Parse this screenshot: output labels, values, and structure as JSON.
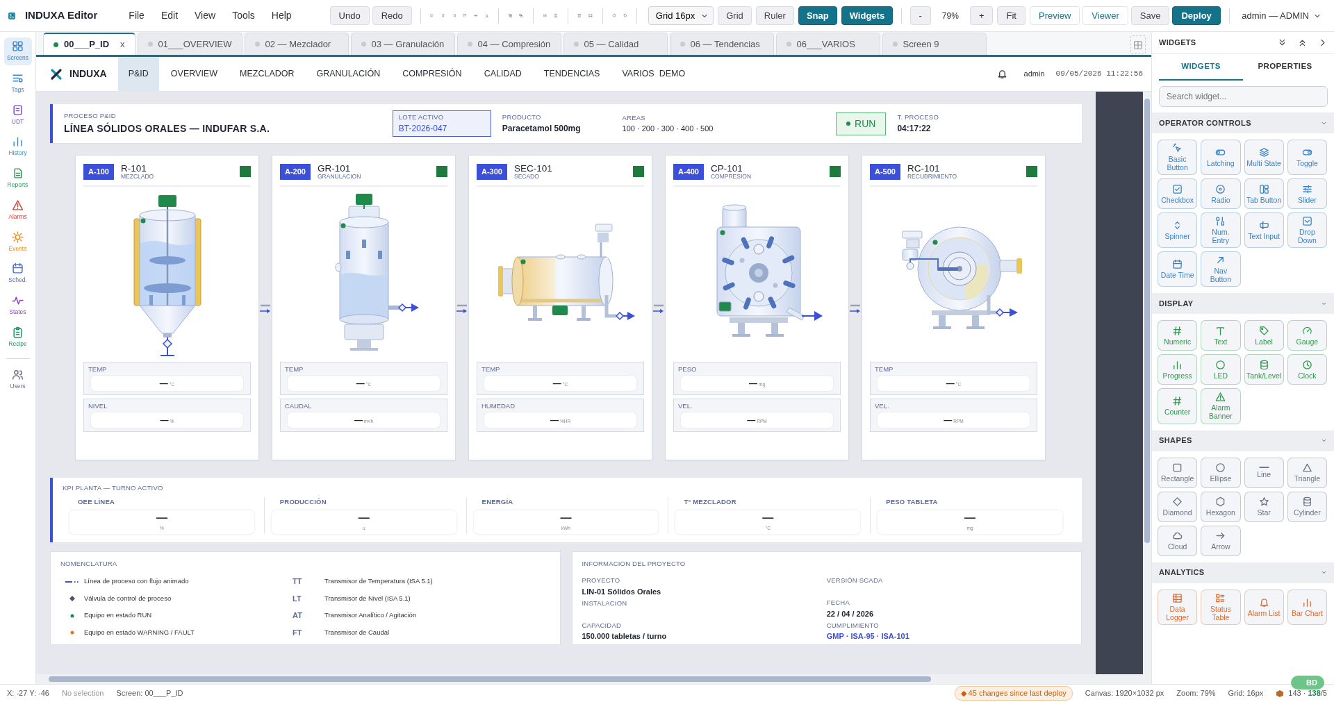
{
  "app": {
    "title": "INDUXA Editor",
    "menu": [
      "File",
      "Edit",
      "View",
      "Tools",
      "Help"
    ],
    "history_buttons": [
      "Undo",
      "Redo"
    ],
    "grid_select": "Grid 16px",
    "toggles": [
      {
        "label": "Grid",
        "on": false
      },
      {
        "label": "Ruler",
        "on": false
      },
      {
        "label": "Snap",
        "on": true
      },
      {
        "label": "Widgets",
        "on": true
      }
    ],
    "zoom": {
      "minus": "-",
      "value": "79%",
      "plus": "+",
      "fit": "Fit"
    },
    "actions": [
      {
        "label": "Preview",
        "kind": "link"
      },
      {
        "label": "Viewer",
        "kind": "link"
      },
      {
        "label": "Save",
        "kind": "plain"
      },
      {
        "label": "Deploy",
        "kind": "primary"
      }
    ],
    "user": "admin — ADMIN"
  },
  "rail": [
    [
      {
        "label": "Screens",
        "selected": true,
        "color": "#3b82c4"
      },
      {
        "label": "Tags",
        "selected": false,
        "color": "#3b82c4"
      },
      {
        "label": "UDT",
        "selected": false,
        "color": "#7c4dcc"
      },
      {
        "label": "History",
        "selected": false,
        "color": "#3b8fd0"
      },
      {
        "label": "Reports",
        "selected": false,
        "color": "#2e9a5a"
      },
      {
        "label": "Alarms",
        "selected": false,
        "color": "#e0413a"
      },
      {
        "label": "Events",
        "selected": false,
        "color": "#f08c1a"
      },
      {
        "label": "Sched.",
        "selected": false,
        "color": "#4a6fd0"
      },
      {
        "label": "States",
        "selected": false,
        "color": "#8a3fd0"
      },
      {
        "label": "Recipe",
        "selected": false,
        "color": "#1f9a6a"
      }
    ],
    [
      {
        "label": "Users",
        "selected": false,
        "color": "#6b7280"
      }
    ]
  ],
  "tabs": [
    {
      "label": "00___P_ID",
      "selected": true,
      "close": "x"
    },
    {
      "label": "01___OVERVIEW",
      "selected": false
    },
    {
      "label": "02 — Mezclador",
      "selected": false
    },
    {
      "label": "03 — Granulación",
      "selected": false
    },
    {
      "label": "04 — Compresión",
      "selected": false
    },
    {
      "label": "05 — Calidad",
      "selected": false
    },
    {
      "label": "06 — Tendencias",
      "selected": false
    },
    {
      "label": "06___VARIOS",
      "selected": false
    },
    {
      "label": "Screen 9",
      "selected": false
    }
  ],
  "screen_nav": {
    "brand": "INDUXA",
    "items": [
      {
        "label": "P&ID",
        "selected": true
      },
      {
        "label": "OVERVIEW",
        "selected": false
      },
      {
        "label": "MEZCLADOR",
        "selected": false
      },
      {
        "label": "GRANULACIÓN",
        "selected": false
      },
      {
        "label": "COMPRESIÓN",
        "selected": false
      },
      {
        "label": "CALIDAD",
        "selected": false
      },
      {
        "label": "TENDENCIAS",
        "selected": false
      },
      {
        "label": "VARIOS  DEMO",
        "selected": false
      }
    ],
    "user": "admin",
    "datetime": "09/05/2026 11:22:56"
  },
  "header": {
    "section": "PROCESO P&ID",
    "title": "LÍNEA SÓLIDOS ORALES — INDUFAR S.A.",
    "lot": {
      "label": "LOTE ACTIVO",
      "value": "BT-2026-047"
    },
    "product": {
      "label": "PRODUCTO",
      "value": "Paracetamol 500mg"
    },
    "areas": {
      "label": "AREAS",
      "value": "100 · 200 · 300 · 400 · 500"
    },
    "state": {
      "label": "RUN",
      "kind": "run"
    },
    "process_time": {
      "label": "T. PROCESO",
      "value": "04:17:22"
    }
  },
  "equipment": [
    {
      "area": "A-100",
      "tag": "R-101",
      "desc": "MEZCLADO",
      "kind": "mixer",
      "color": "#1f7a3f",
      "readings": [
        {
          "label": "TEMP",
          "value": "—",
          "unit": "°C"
        },
        {
          "label": "NIVEL",
          "value": "—",
          "unit": "%"
        }
      ]
    },
    {
      "area": "A-200",
      "tag": "GR-101",
      "desc": "GRANULACION",
      "kind": "granulator",
      "color": "#1f7a3f",
      "readings": [
        {
          "label": "TEMP",
          "value": "—",
          "unit": "°C"
        },
        {
          "label": "CAUDAL",
          "value": "—",
          "unit": "m³/h"
        }
      ]
    },
    {
      "area": "A-300",
      "tag": "SEC-101",
      "desc": "SECADO",
      "kind": "dryer",
      "color": "#1f7a3f",
      "readings": [
        {
          "label": "TEMP",
          "value": "—",
          "unit": "°C"
        },
        {
          "label": "HUMEDAD",
          "value": "—",
          "unit": "%HR"
        }
      ]
    },
    {
      "area": "A-400",
      "tag": "CP-101",
      "desc": "COMPRESION",
      "kind": "press",
      "color": "#1f7a3f",
      "readings": [
        {
          "label": "PESO",
          "value": "—",
          "unit": "mg"
        },
        {
          "label": "VEL.",
          "value": "—",
          "unit": "RPM"
        }
      ]
    },
    {
      "area": "A-500",
      "tag": "RC-101",
      "desc": "RECUBRIMIENTO",
      "kind": "coater",
      "color": "#1f7a3f",
      "readings": [
        {
          "label": "TEMP",
          "value": "—",
          "unit": "°C"
        },
        {
          "label": "VEL.",
          "value": "—",
          "unit": "RPM"
        }
      ]
    }
  ],
  "kpi": {
    "title": "KPI PLANTA — TURNO ACTIVO",
    "items": [
      {
        "label": "OEE LÍNEA",
        "value": "—",
        "unit": "%"
      },
      {
        "label": "PRODUCCIÓN",
        "value": "—",
        "unit": "u"
      },
      {
        "label": "ENERGÍA",
        "value": "—",
        "unit": "kWh"
      },
      {
        "label": "T° MEZCLADOR",
        "value": "—",
        "unit": "°C"
      },
      {
        "label": "PESO TABLETA",
        "value": "—",
        "unit": "mg"
      }
    ]
  },
  "nomenclature": {
    "title": "NOMENCLATURA",
    "items": [
      {
        "kind": "flow-line",
        "text": "Línea de proceso con flujo animado"
      },
      {
        "kind": "valve",
        "text": "Válvula de control de proceso"
      },
      {
        "kind": "run",
        "text": "Equipo en estado RUN"
      },
      {
        "kind": "fault",
        "text": "Equipo en estado WARNING / FAULT"
      }
    ],
    "codes": [
      {
        "code": "TT",
        "text": "Transmisor de Temperatura (ISA 5.1)"
      },
      {
        "code": "LT",
        "text": "Transmisor de Nivel (ISA 5.1)"
      },
      {
        "code": "AT",
        "text": "Transmisor Analítico / Agitación"
      },
      {
        "code": "FT",
        "text": "Transmisor de Caudal"
      }
    ]
  },
  "project": {
    "title": "INFORMACION DEL PROYECTO",
    "columns": [
      [
        {
          "label": "PROYECTO",
          "value": "LIN-01 Sólidos Orales",
          "accent": false
        },
        {
          "label": "INSTALACION",
          "accent": false
        },
        {
          "label": "CAPACIDAD",
          "value": "150.000 tabletas / turno",
          "accent": false
        }
      ],
      [
        {
          "label": "VERSIÓN SCADA",
          "accent": false
        },
        {
          "label": "FECHA",
          "value": "22 / 04 / 2026",
          "accent": false
        },
        {
          "label": "CUMPLIMIENTO",
          "value": "GMP · ISA-95 · ISA-101",
          "accent": true
        }
      ]
    ]
  },
  "panel": {
    "title": "WIDGETS",
    "tabs": [
      {
        "label": "WIDGETS",
        "selected": true
      },
      {
        "label": "PROPERTIES",
        "selected": false
      }
    ],
    "search": {
      "placeholder": "Search widget..."
    },
    "sections": [
      {
        "title": "OPERATOR CONTROLS",
        "color": "#3b82c4",
        "items": [
          "Basic Button",
          "Latching",
          "Multi State",
          "Toggle",
          "Checkbox",
          "Radio",
          "Tab Button",
          "Slider",
          "Spinner",
          "Num. Entry",
          "Text Input",
          "Drop Down",
          "Date Time",
          "Nav Button"
        ]
      },
      {
        "title": "DISPLAY",
        "color": "#2e9a4a",
        "items": [
          "Numeric",
          "Text",
          "Label",
          "Gauge",
          "Progress",
          "LED",
          "Tank/Level",
          "Clock",
          "Counter",
          "Alarm Banner"
        ]
      },
      {
        "title": "SHAPES",
        "color": "#6b7280",
        "items": [
          "Rectangle",
          "Ellipse",
          "Line",
          "Triangle",
          "Diamond",
          "Hexagon",
          "Star",
          "Cylinder",
          "Cloud",
          "Arrow"
        ]
      },
      {
        "title": "ANALYTICS",
        "color": "#e0692a",
        "items": [
          "Data Logger",
          "Status Table",
          "Alarm List",
          "Bar Chart"
        ]
      }
    ]
  },
  "status_bar": {
    "position": "X: -27 Y: -46",
    "selection": "No selection",
    "screen": "Screen: 00___P_ID",
    "changes": "◆ 45 changes since last deploy",
    "canvas": "Canvas: 1920×1032 px",
    "zoom": "Zoom: 79%",
    "grid": "Grid: 16px",
    "counts": "143 · **138**/5",
    "chip": "BD"
  }
}
